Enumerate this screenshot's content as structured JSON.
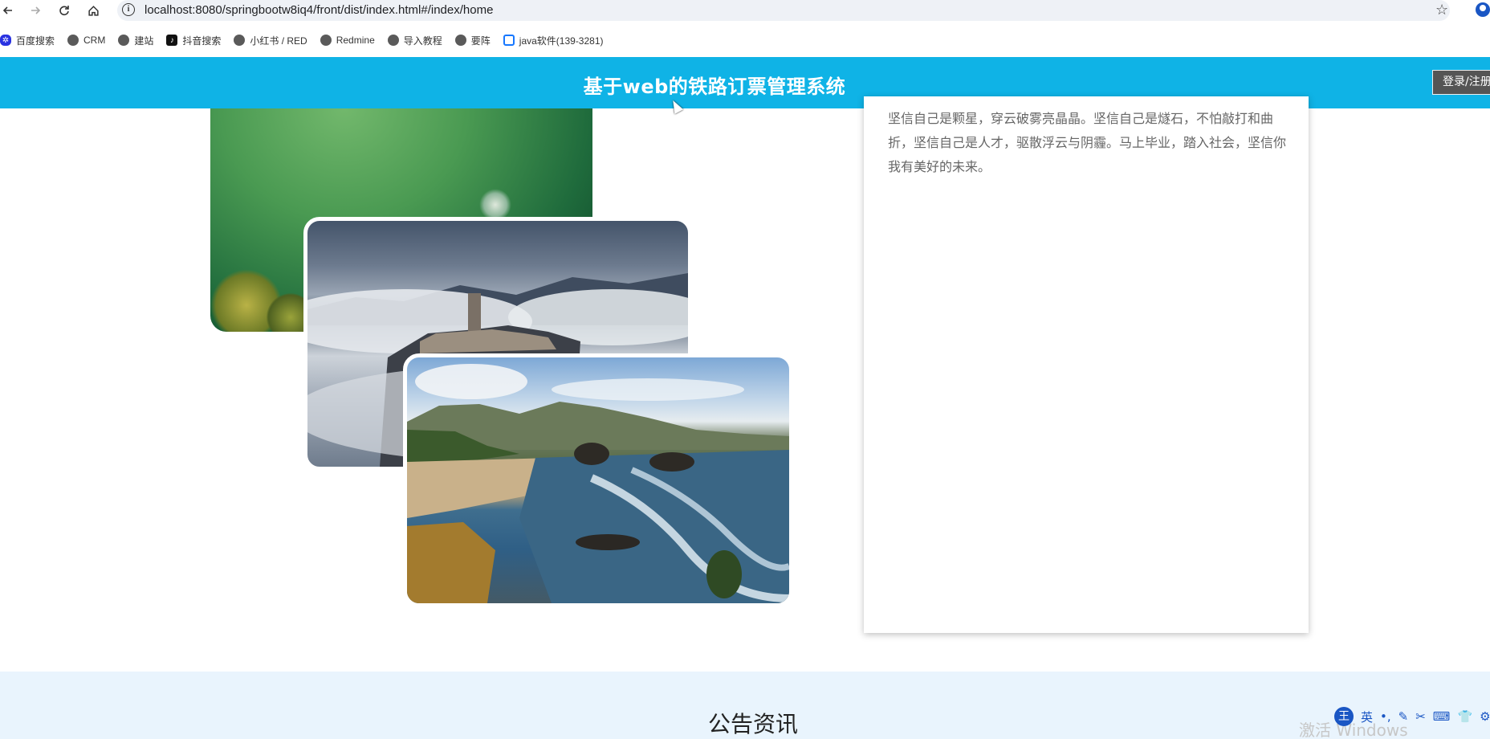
{
  "browser": {
    "url": "localhost:8080/springbootw8iq4/front/dist/index.html#/index/home",
    "bookmarks": [
      {
        "label": "百度搜索",
        "icon": "baidu-paw-icon"
      },
      {
        "label": "CRM",
        "icon": "globe-icon"
      },
      {
        "label": "建站",
        "icon": "globe-icon"
      },
      {
        "label": "抖音搜索",
        "icon": "tiktok-icon"
      },
      {
        "label": "小红书 / RED",
        "icon": "globe-icon"
      },
      {
        "label": "Redmine",
        "icon": "globe-icon"
      },
      {
        "label": "导入教程",
        "icon": "globe-icon"
      },
      {
        "label": "要阵",
        "icon": "globe-icon"
      },
      {
        "label": "java软件(139-3281)",
        "icon": "bilibili-tv-icon"
      }
    ]
  },
  "site": {
    "title": "基于web的铁路订票管理系统",
    "login_label": "登录/注册"
  },
  "intro": {
    "text": "坚信自己是颗星，穿云破雾亮晶晶。坚信自己是燧石，不怕敲打和曲折，坚信自己是人才，驱散浮云与阴霾。马上毕业，踏入社会，坚信你我有美好的未来。"
  },
  "notice": {
    "title": "公告资讯"
  },
  "system": {
    "watermark": "激活 Windows",
    "ime_wang": "王",
    "ime_lang": "英"
  }
}
